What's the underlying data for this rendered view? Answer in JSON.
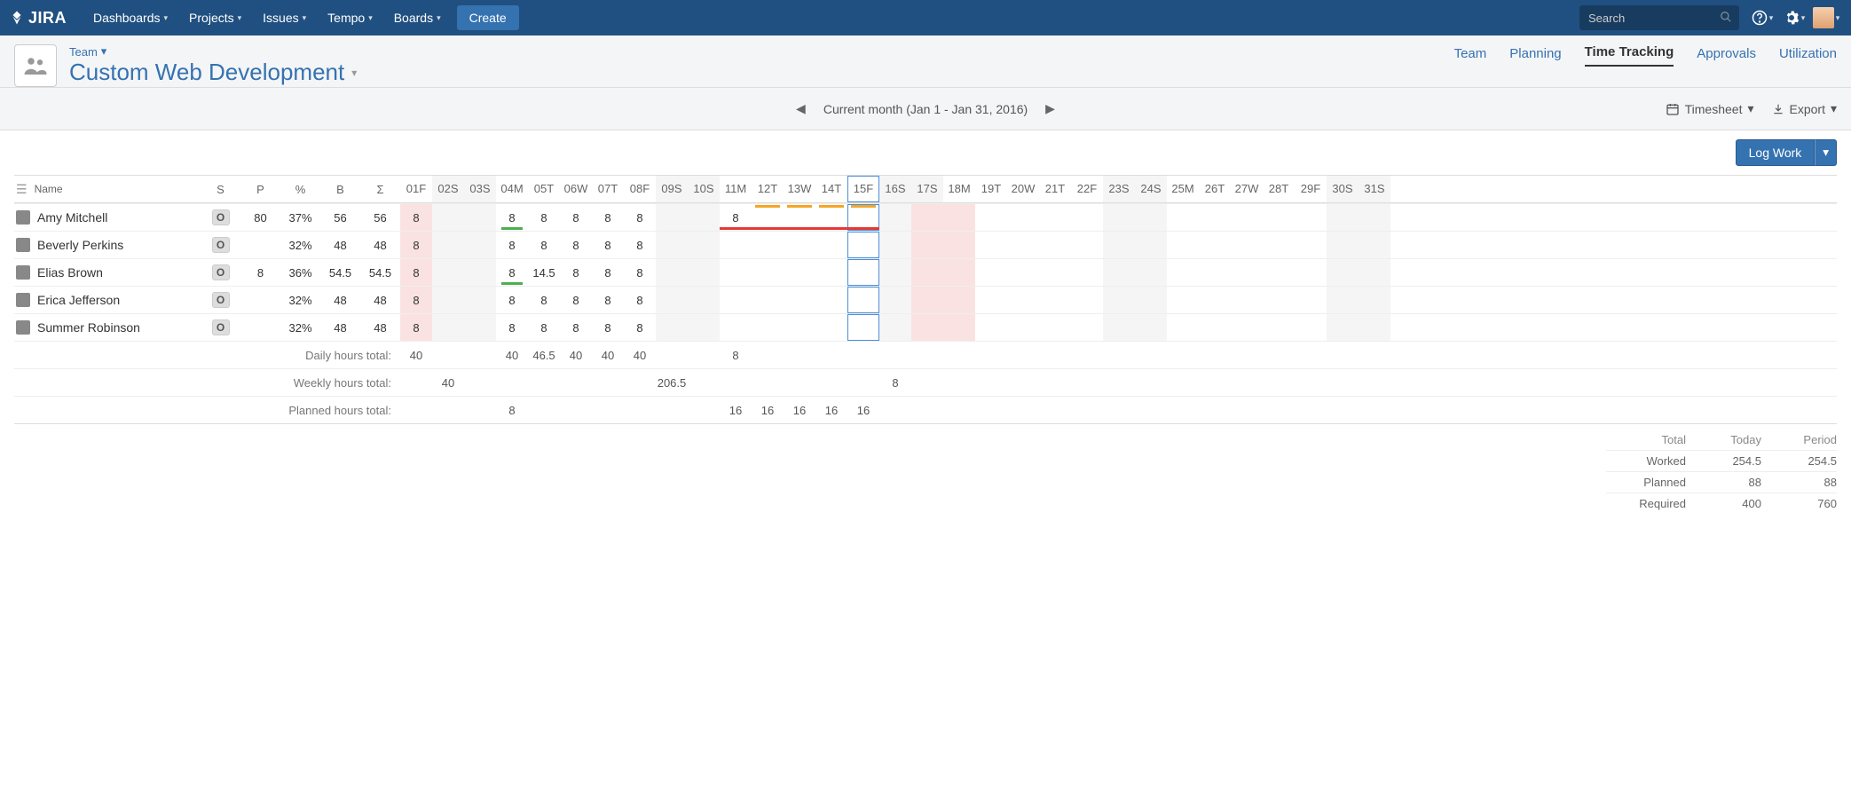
{
  "topnav": {
    "logo": "JIRA",
    "items": [
      "Dashboards",
      "Projects",
      "Issues",
      "Tempo",
      "Boards"
    ],
    "create": "Create",
    "search_placeholder": "Search"
  },
  "page": {
    "breadcrumb": "Team",
    "title": "Custom Web Development",
    "tabs": [
      "Team",
      "Planning",
      "Time Tracking",
      "Approvals",
      "Utilization"
    ],
    "active_tab": "Time Tracking"
  },
  "toolbar": {
    "period_label": "Current month (Jan 1 - Jan 31, 2016)",
    "view_label": "Timesheet",
    "export_label": "Export"
  },
  "buttons": {
    "log_work": "Log Work"
  },
  "columns": {
    "name": "Name",
    "s": "S",
    "p": "P",
    "pct": "%",
    "b": "B",
    "sigma": "Σ"
  },
  "days": [
    {
      "n": "01",
      "d": "F",
      "weekend": false,
      "pink": true
    },
    {
      "n": "02",
      "d": "S",
      "weekend": true,
      "pink": false
    },
    {
      "n": "03",
      "d": "S",
      "weekend": true,
      "pink": false
    },
    {
      "n": "04",
      "d": "M",
      "weekend": false,
      "pink": false
    },
    {
      "n": "05",
      "d": "T",
      "weekend": false,
      "pink": false
    },
    {
      "n": "06",
      "d": "W",
      "weekend": false,
      "pink": false
    },
    {
      "n": "07",
      "d": "T",
      "weekend": false,
      "pink": false
    },
    {
      "n": "08",
      "d": "F",
      "weekend": false,
      "pink": false
    },
    {
      "n": "09",
      "d": "S",
      "weekend": true,
      "pink": false
    },
    {
      "n": "10",
      "d": "S",
      "weekend": true,
      "pink": false
    },
    {
      "n": "11",
      "d": "M",
      "weekend": false,
      "pink": false
    },
    {
      "n": "12",
      "d": "T",
      "weekend": false,
      "pink": false
    },
    {
      "n": "13",
      "d": "W",
      "weekend": false,
      "pink": false
    },
    {
      "n": "14",
      "d": "T",
      "weekend": false,
      "pink": false
    },
    {
      "n": "15",
      "d": "F",
      "weekend": false,
      "pink": false,
      "today": true
    },
    {
      "n": "16",
      "d": "S",
      "weekend": true,
      "pink": false
    },
    {
      "n": "17",
      "d": "S",
      "weekend": true,
      "pink": true
    },
    {
      "n": "18",
      "d": "M",
      "weekend": false,
      "pink": true
    },
    {
      "n": "19",
      "d": "T",
      "weekend": false,
      "pink": false
    },
    {
      "n": "20",
      "d": "W",
      "weekend": false,
      "pink": false
    },
    {
      "n": "21",
      "d": "T",
      "weekend": false,
      "pink": false
    },
    {
      "n": "22",
      "d": "F",
      "weekend": false,
      "pink": false
    },
    {
      "n": "23",
      "d": "S",
      "weekend": true,
      "pink": false
    },
    {
      "n": "24",
      "d": "S",
      "weekend": true,
      "pink": false
    },
    {
      "n": "25",
      "d": "M",
      "weekend": false,
      "pink": false
    },
    {
      "n": "26",
      "d": "T",
      "weekend": false,
      "pink": false
    },
    {
      "n": "27",
      "d": "W",
      "weekend": false,
      "pink": false
    },
    {
      "n": "28",
      "d": "T",
      "weekend": false,
      "pink": false
    },
    {
      "n": "29",
      "d": "F",
      "weekend": false,
      "pink": false
    },
    {
      "n": "30",
      "d": "S",
      "weekend": true,
      "pink": false
    },
    {
      "n": "31",
      "d": "S",
      "weekend": true,
      "pink": false
    }
  ],
  "members": [
    {
      "name": "Amy Mitchell",
      "s": "O",
      "p": "80",
      "pct": "37%",
      "b": "56",
      "sigma": "56",
      "cells": [
        "8",
        "",
        "",
        "8",
        "8",
        "8",
        "8",
        "8",
        "",
        "",
        "8",
        "",
        "",
        "",
        "",
        "",
        "",
        "",
        "",
        "",
        "",
        "",
        "",
        "",
        "",
        "",
        "",
        "",
        "",
        "",
        ""
      ],
      "green": [
        3
      ],
      "red": [
        10,
        11,
        12,
        13,
        14
      ],
      "yellow": [
        11,
        12,
        13,
        14
      ]
    },
    {
      "name": "Beverly Perkins",
      "s": "O",
      "p": "",
      "pct": "32%",
      "b": "48",
      "sigma": "48",
      "cells": [
        "8",
        "",
        "",
        "8",
        "8",
        "8",
        "8",
        "8",
        "",
        "",
        "",
        "",
        "",
        "",
        "",
        "",
        "",
        "",
        "",
        "",
        "",
        "",
        "",
        "",
        "",
        "",
        "",
        "",
        "",
        "",
        ""
      ],
      "green": [],
      "red": [],
      "yellow": []
    },
    {
      "name": "Elias Brown",
      "s": "O",
      "p": "8",
      "pct": "36%",
      "b": "54.5",
      "sigma": "54.5",
      "cells": [
        "8",
        "",
        "",
        "8",
        "14.5",
        "8",
        "8",
        "8",
        "",
        "",
        "",
        "",
        "",
        "",
        "",
        "",
        "",
        "",
        "",
        "",
        "",
        "",
        "",
        "",
        "",
        "",
        "",
        "",
        "",
        "",
        ""
      ],
      "green": [
        3
      ],
      "red": [],
      "yellow": []
    },
    {
      "name": "Erica Jefferson",
      "s": "O",
      "p": "",
      "pct": "32%",
      "b": "48",
      "sigma": "48",
      "cells": [
        "8",
        "",
        "",
        "8",
        "8",
        "8",
        "8",
        "8",
        "",
        "",
        "",
        "",
        "",
        "",
        "",
        "",
        "",
        "",
        "",
        "",
        "",
        "",
        "",
        "",
        "",
        "",
        "",
        "",
        "",
        "",
        ""
      ],
      "green": [],
      "red": [],
      "yellow": []
    },
    {
      "name": "Summer Robinson",
      "s": "O",
      "p": "",
      "pct": "32%",
      "b": "48",
      "sigma": "48",
      "cells": [
        "8",
        "",
        "",
        "8",
        "8",
        "8",
        "8",
        "8",
        "",
        "",
        "",
        "",
        "",
        "",
        "",
        "",
        "",
        "",
        "",
        "",
        "",
        "",
        "",
        "",
        "",
        "",
        "",
        "",
        "",
        "",
        ""
      ],
      "green": [],
      "red": [],
      "yellow": []
    }
  ],
  "totals": {
    "daily_label": "Daily hours total:",
    "daily": [
      "40",
      "",
      "",
      "40",
      "46.5",
      "40",
      "40",
      "40",
      "",
      "",
      "8",
      "",
      "",
      "",
      "",
      "",
      "",
      "",
      "",
      "",
      "",
      "",
      "",
      "",
      "",
      "",
      "",
      "",
      "",
      "",
      ""
    ],
    "weekly_label": "Weekly hours total:",
    "weekly": [
      "",
      "40",
      "",
      "",
      "",
      "",
      "",
      "",
      "206.5",
      "",
      "",
      "",
      "",
      "",
      "",
      "8",
      "",
      "",
      "",
      "",
      "",
      "",
      "",
      "",
      "",
      "",
      "",
      "",
      "",
      "",
      ""
    ],
    "planned_label": "Planned hours total:",
    "planned": [
      "",
      "",
      "",
      "8",
      "",
      "",
      "",
      "",
      "",
      "",
      "16",
      "16",
      "16",
      "16",
      "16",
      "",
      "",
      "",
      "",
      "",
      "",
      "",
      "",
      "",
      "",
      "",
      "",
      "",
      "",
      "",
      ""
    ]
  },
  "summary": {
    "head": [
      "Total",
      "Today",
      "Period"
    ],
    "rows": [
      {
        "label": "Worked",
        "today": "254.5",
        "period": "254.5"
      },
      {
        "label": "Planned",
        "today": "88",
        "period": "88"
      },
      {
        "label": "Required",
        "today": "400",
        "period": "760"
      }
    ]
  }
}
